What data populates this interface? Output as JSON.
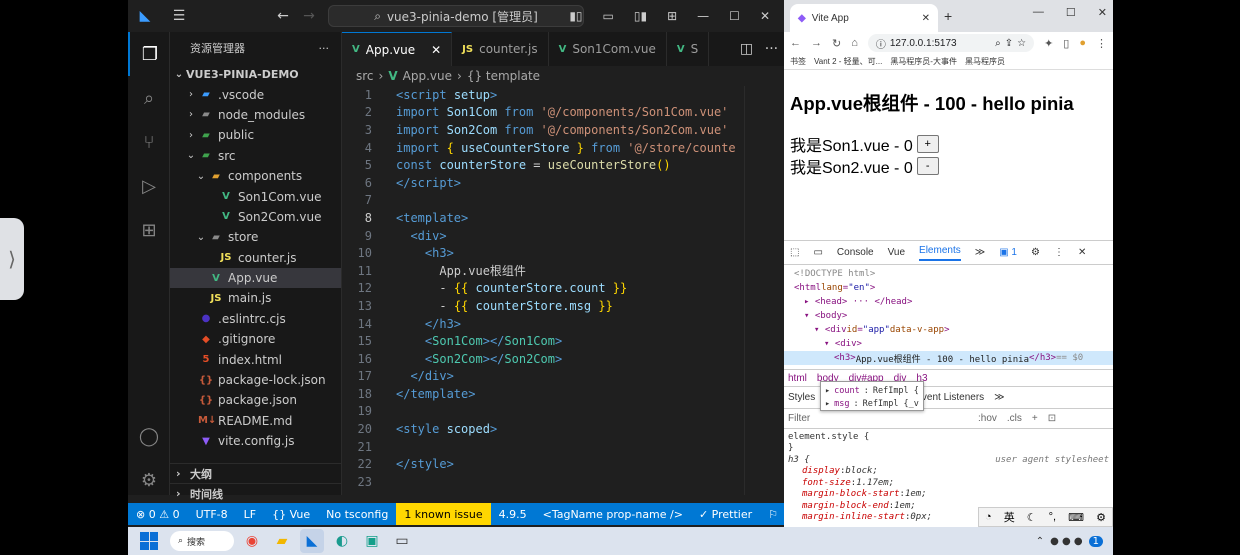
{
  "vscode": {
    "title": "vue3-pinia-demo [管理员]",
    "explorer": {
      "header": "资源管理器",
      "root": "VUE3-PINIA-DEMO",
      "items": [
        {
          "label": ".vscode",
          "icon": "vscode-folder-icon",
          "chev": "›",
          "indent": 0
        },
        {
          "label": "node_modules",
          "icon": "folder-icon",
          "chev": "›",
          "indent": 0
        },
        {
          "label": "public",
          "icon": "public-folder-icon",
          "chev": "›",
          "indent": 0
        },
        {
          "label": "src",
          "icon": "src-folder-icon",
          "chev": "⌄",
          "indent": 0
        },
        {
          "label": "components",
          "icon": "components-folder-icon",
          "chev": "⌄",
          "indent": 1
        },
        {
          "label": "Son1Com.vue",
          "icon": "vue-file-icon",
          "chev": "",
          "indent": 2
        },
        {
          "label": "Son2Com.vue",
          "icon": "vue-file-icon",
          "chev": "",
          "indent": 2
        },
        {
          "label": "store",
          "icon": "folder-icon",
          "chev": "⌄",
          "indent": 1
        },
        {
          "label": "counter.js",
          "icon": "js-file-icon",
          "chev": "",
          "indent": 2
        },
        {
          "label": "App.vue",
          "icon": "vue-file-icon",
          "chev": "",
          "indent": 1,
          "selected": true
        },
        {
          "label": "main.js",
          "icon": "js-file-icon",
          "chev": "",
          "indent": 1
        },
        {
          "label": ".eslintrc.cjs",
          "icon": "eslint-file-icon",
          "chev": "",
          "indent": 0
        },
        {
          "label": ".gitignore",
          "icon": "git-file-icon",
          "chev": "",
          "indent": 0
        },
        {
          "label": "index.html",
          "icon": "html-file-icon",
          "chev": "",
          "indent": 0
        },
        {
          "label": "package-lock.json",
          "icon": "json-file-icon",
          "chev": "",
          "indent": 0
        },
        {
          "label": "package.json",
          "icon": "json-file-icon",
          "chev": "",
          "indent": 0
        },
        {
          "label": "README.md",
          "icon": "markdown-file-icon",
          "chev": "",
          "indent": 0
        },
        {
          "label": "vite.config.js",
          "icon": "vite-file-icon",
          "chev": "",
          "indent": 0
        }
      ],
      "outline": "大纲",
      "timeline": "时间线"
    },
    "tabs": [
      {
        "label": "App.vue",
        "icon": "vue-file-icon",
        "active": true
      },
      {
        "label": "counter.js",
        "icon": "js-file-icon",
        "active": false
      },
      {
        "label": "Son1Com.vue",
        "icon": "vue-file-icon",
        "active": false
      },
      {
        "label": "S",
        "icon": "vue-file-icon",
        "active": false
      }
    ],
    "breadcrumb": {
      "a": "src",
      "b": "App.vue",
      "c": "{} template"
    },
    "code": [
      {
        "n": "1",
        "html": "<span class=\"k\">&lt;script</span> <span class=\"v\">setup</span><span class=\"k\">&gt;</span>"
      },
      {
        "n": "2",
        "html": "<span class=\"k\">import</span> <span class=\"v\">Son1Com</span> <span class=\"k\">from</span> <span class=\"s\">'@/components/Son1Com.vue'</span>"
      },
      {
        "n": "3",
        "html": "<span class=\"k\">import</span> <span class=\"v\">Son2Com</span> <span class=\"k\">from</span> <span class=\"s\">'@/components/Son2Com.vue'</span>"
      },
      {
        "n": "4",
        "html": "<span class=\"k\">import</span> <span class=\"y\">{</span> <span class=\"v\">useCounterStore</span> <span class=\"y\">}</span> <span class=\"k\">from</span> <span class=\"s\">'@/store/counte</span>"
      },
      {
        "n": "5",
        "html": "<span class=\"k\">const</span> <span class=\"v\">counterStore</span> <span class=\"p\">=</span> <span class=\"f\">useCounterStore</span><span class=\"y\">()</span>"
      },
      {
        "n": "6",
        "html": "<span class=\"k\">&lt;/script&gt;</span>"
      },
      {
        "n": "7",
        "html": ""
      },
      {
        "n": "8",
        "html": "<span class=\"k\">&lt;template&gt;</span>"
      },
      {
        "n": "9",
        "html": "  <span class=\"k\">&lt;div&gt;</span>"
      },
      {
        "n": "10",
        "html": "    <span class=\"k\">&lt;h3&gt;</span>"
      },
      {
        "n": "11",
        "html": "      <span class=\"p\">App.vue根组件</span>"
      },
      {
        "n": "12",
        "html": "      <span class=\"p\">-</span> <span class=\"y\">{{</span> <span class=\"v\">counterStore.count</span> <span class=\"y\">}}</span>"
      },
      {
        "n": "13",
        "html": "      <span class=\"p\">-</span> <span class=\"y\">{{</span> <span class=\"v\">counterStore.msg</span> <span class=\"y\">}}</span>"
      },
      {
        "n": "14",
        "html": "    <span class=\"k\">&lt;/h3&gt;</span>"
      },
      {
        "n": "15",
        "html": "    <span class=\"k\">&lt;</span><span class=\"t\">Son1Com</span><span class=\"k\">&gt;&lt;/</span><span class=\"t\">Son1Com</span><span class=\"k\">&gt;</span>"
      },
      {
        "n": "16",
        "html": "    <span class=\"k\">&lt;</span><span class=\"t\">Son2Com</span><span class=\"k\">&gt;&lt;/</span><span class=\"t\">Son2Com</span><span class=\"k\">&gt;</span>"
      },
      {
        "n": "17",
        "html": "  <span class=\"k\">&lt;/div&gt;</span>"
      },
      {
        "n": "18",
        "html": "<span class=\"k\">&lt;/template&gt;</span>"
      },
      {
        "n": "19",
        "html": ""
      },
      {
        "n": "20",
        "html": "<span class=\"k\">&lt;style</span> <span class=\"v\">scoped</span><span class=\"k\">&gt;</span>"
      },
      {
        "n": "21",
        "html": ""
      },
      {
        "n": "22",
        "html": "<span class=\"k\">&lt;/style&gt;</span>"
      },
      {
        "n": "23",
        "html": ""
      }
    ],
    "current_line": "8",
    "status": {
      "problems": "⊗ 0 ⚠ 0",
      "encoding": "UTF-8",
      "eol": "LF",
      "language": "{} Vue",
      "tsconfig": "No tsconfig",
      "issue": "1 known issue",
      "version": "4.9.5",
      "tag": "<TagName prop-name />",
      "prettier": "✓ Prettier"
    }
  },
  "browser": {
    "tab_title": "Vite App",
    "url": "127.0.0.1:5173",
    "bookmarks": [
      "书签",
      "Vant 2 - 轻量、可...",
      "黑马程序员-大事件",
      "黑马程序员"
    ],
    "page": {
      "heading": "App.vue根组件 - 100 - hello pinia",
      "son1": "我是Son1.vue - 0",
      "son1_btn": "+",
      "son2": "我是Son2.vue - 0",
      "son2_btn": "-"
    },
    "devtools": {
      "tabs": [
        "Console",
        "Vue",
        "Elements"
      ],
      "active_tab": "Elements",
      "badge": "1",
      "dom": [
        {
          "indent": 0,
          "html": "<span class=\"cmt\">&lt;!DOCTYPE html&gt;</span>"
        },
        {
          "indent": 0,
          "html": "&lt;html <span class=\"attr\">lang</span>=<span class=\"aval\">\"en\"</span>&gt;"
        },
        {
          "indent": 1,
          "html": "▸ &lt;head&gt; ··· &lt;/head&gt;"
        },
        {
          "indent": 1,
          "html": "▾ &lt;body&gt;"
        },
        {
          "indent": 2,
          "html": "▾ &lt;div <span class=\"attr\">id</span>=<span class=\"aval\">\"app\"</span> <span class=\"attr\">data-v-app</span>&gt;"
        },
        {
          "indent": 3,
          "html": "▾ &lt;div&gt;"
        },
        {
          "indent": 4,
          "html": "&lt;h3&gt; <span class=\"txt\">App.vue根组件 - 100 - hello pinia</span>&lt;/h3&gt; <span class=\"cmt\">== $0</span>",
          "hl": true
        }
      ],
      "crumbs": [
        "html",
        "body",
        "div#app",
        "div",
        "h3"
      ],
      "subtabs": [
        "Styles",
        "Event Listeners"
      ],
      "popover": [
        {
          "key": "count",
          "val": "RefImpl {"
        },
        {
          "key": "msg",
          "val": "RefImpl {_v"
        }
      ],
      "filter": {
        "placeholder": "Filter",
        "hov": ":hov",
        "cls": ".cls"
      },
      "styles": [
        {
          "sel": "element.style {",
          "prop": "",
          "val": ""
        },
        {
          "sel": "}",
          "prop": "",
          "val": ""
        },
        {
          "sel": "h3 {",
          "prop": "",
          "val": "",
          "ua": "user agent stylesheet"
        },
        {
          "sel": "",
          "prop": "display",
          "val": "block;"
        },
        {
          "sel": "",
          "prop": "font-size",
          "val": "1.17em;"
        },
        {
          "sel": "",
          "prop": "margin-block-start",
          "val": "1em;"
        },
        {
          "sel": "",
          "prop": "margin-block-end",
          "val": "1em;"
        },
        {
          "sel": "",
          "prop": "margin-inline-start",
          "val": "0px;"
        }
      ],
      "ime": "英"
    }
  },
  "taskbar": {
    "search": "搜索"
  },
  "colors": {
    "vscode_accent": "#0078d4",
    "status_warn": "#ffd700",
    "vue_green": "#42b883",
    "js_yellow": "#f1e05a"
  }
}
